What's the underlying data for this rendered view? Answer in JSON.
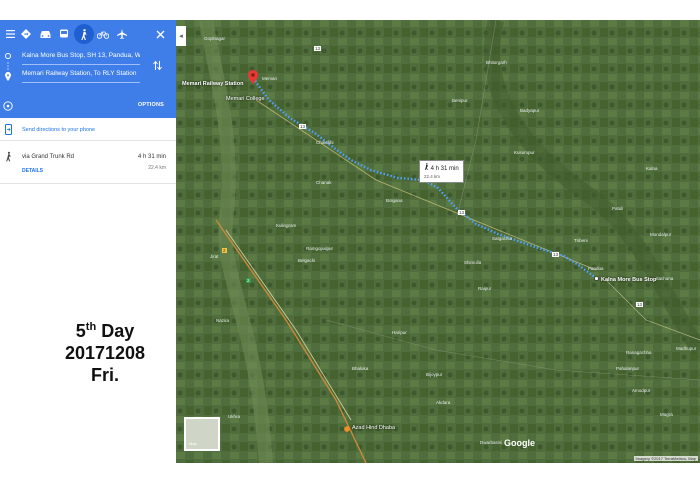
{
  "sidebar": {
    "origin": "Kalna More Bus Stop, SH 13, Pandua, W",
    "destination": "Memari Railway Station, To RLY Station",
    "options_label": "OPTIONS",
    "send_label": "Send directions to your phone",
    "route": {
      "via": "via Grand Trunk Rd",
      "duration": "4 h 31 min",
      "distance": "22.4 km",
      "details_label": "DETAILS"
    }
  },
  "note": {
    "line1_main": "5",
    "line1_sup": "th",
    "line1_rest": " Day",
    "line2": "20171208",
    "line3": "Fri."
  },
  "map": {
    "start_label": "Memari Railway Station",
    "end_label": "Kalna More Bus Stop",
    "callout_time": "4 h 31 min",
    "callout_dist": "22.4 km",
    "college": "Memari College",
    "dhaba": "Azad Hind Dhaba",
    "google": "Google",
    "attribution": "Imagery ©2017 TerraMetrics, Map",
    "thumb_label": "Map",
    "places": [
      "Goplnagar",
      "Memari",
      "Benipur",
      "Bhitorgarh",
      "Badyapur",
      "Chakdihi",
      "Bolgana",
      "Kulingram",
      "Ramgopalpur",
      "Satgachia",
      "Pandua",
      "Kalna",
      "Patuli",
      "Mondalpur",
      "Tribeni",
      "Madhupur",
      "Raipur",
      "Haripur",
      "Chanak",
      "Shimulia",
      "Nazira",
      "Bhaluka",
      "Belgachi",
      "Ukhra",
      "Akdara",
      "Bijoypur",
      "Dwarbasini",
      "Ranagachha",
      "Jirat",
      "Amodpur",
      "Pahalanpur",
      "Mugra",
      "Kusumpur",
      "Itachuna"
    ],
    "road_labels": [
      "13",
      "13",
      "13",
      "13",
      "2",
      "2",
      "13"
    ]
  },
  "colors": {
    "accent": "#3f7ee8",
    "route_dots": "#4fa3ff",
    "map_bg": "#4d6b3a"
  }
}
